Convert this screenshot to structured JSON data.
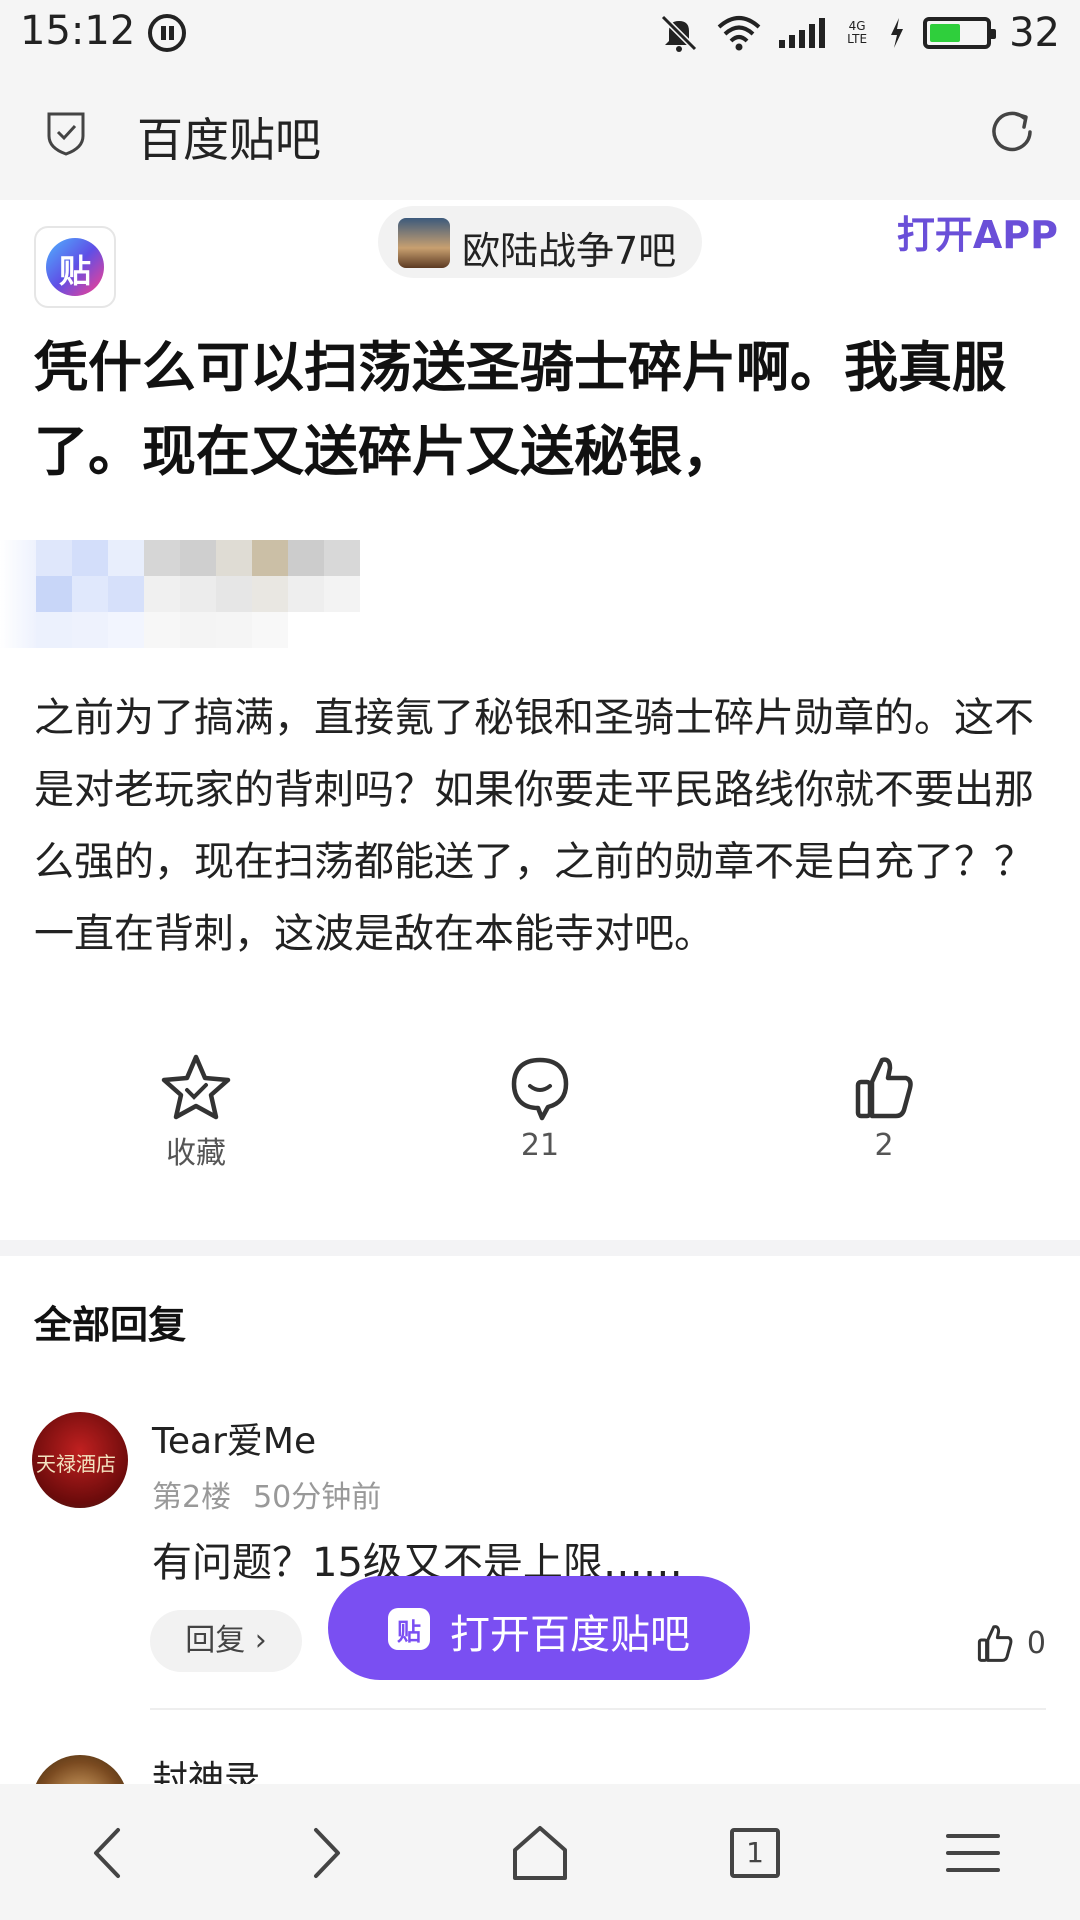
{
  "status_bar": {
    "time": "15:12",
    "network": "4G LTE",
    "battery_level": "32",
    "colors": {
      "battery_fill": "#2fcf3c"
    }
  },
  "browser": {
    "title": "百度贴吧",
    "icons": [
      "shield-check-icon",
      "refresh-icon"
    ]
  },
  "header": {
    "forum_name": "欧陆战争7吧",
    "open_app_label": "打开APP",
    "logo_glyph": "贴"
  },
  "post": {
    "title": "凭什么可以扫荡送圣骑士碎片啊。我真服了。现在又送碎片又送秘银，",
    "body": "之前为了搞满，直接氪了秘银和圣骑士碎片勋章的。这不是对老玩家的背刺吗？如果你要走平民路线你就不要出那么强的，现在扫荡都能送了，之前的勋章不是白充了？？一直在背刺，这波是敌在本能寺对吧。",
    "actions": {
      "favorite_label": "收藏",
      "comment_count": "21",
      "like_count": "2"
    }
  },
  "replies": {
    "section_title": "全部回复",
    "items": [
      {
        "username": "Tear爱Me",
        "floor": "第2楼",
        "time": "50分钟前",
        "text": "有问题？15级又不是上限……",
        "reply_label": "回复 ›",
        "likes": "0"
      },
      {
        "username": "封神录"
      }
    ]
  },
  "floating_button": {
    "label": "打开百度贴吧",
    "icon_glyph": "贴",
    "color": "#7a4ff2"
  },
  "bottom_nav": {
    "tab_count": "1",
    "icons": [
      "back-icon",
      "forward-icon",
      "home-icon",
      "tabs-icon",
      "menu-icon"
    ]
  }
}
